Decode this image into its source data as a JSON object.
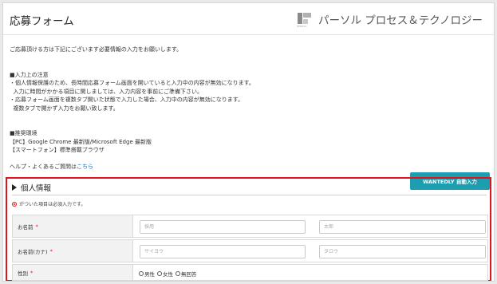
{
  "header": {
    "title": "応募フォーム",
    "logo_text": "パーソル プロセス＆テクノロジー",
    "logo_caption": "PERSOL"
  },
  "intro": {
    "lead": "ご応募頂ける方は下記にございます必要情報の入力をお願いします。",
    "notes_heading": "■入力上の注意",
    "notes": [
      "・個人情報保護のため、長時間応募フォーム画面を開いていると入力中の内容が無効になります。",
      "  入力に時間がかかる項目に関しましては、入力内容を事前にご準備下さい。",
      "・応募フォーム画面を複数タブ開いた状態で入力した場合、入力中の内容が無効になります。",
      "  複数タブで開かず入力をお願い致します。"
    ],
    "env_heading": "■推奨環境",
    "env": [
      "【PC】Google Chrome 最新版/Microsoft Edge 最新版",
      "【スマートフォン】標準搭載ブラウザ"
    ],
    "help_prefix": "ヘルプ・よくあるご質問は",
    "help_link": "こちら"
  },
  "wantedly_button": "WANTEDLY 自動入力",
  "section": {
    "title": "個人情報",
    "required_note": "がついた項目は必須入力です。",
    "rows": [
      {
        "label": "お名前",
        "required": "*",
        "placeholders": [
          "採用",
          "太郎"
        ]
      },
      {
        "label": "お名前(カナ)",
        "required": "*",
        "placeholders": [
          "サイヨウ",
          "タロウ"
        ]
      },
      {
        "label": "性別",
        "required": "*",
        "options": [
          "男性",
          "女性",
          "無回答"
        ]
      }
    ]
  },
  "colors": {
    "highlight_border": "#e0141e",
    "button_bg": "#1c9db0",
    "link": "#1a6fb5"
  }
}
